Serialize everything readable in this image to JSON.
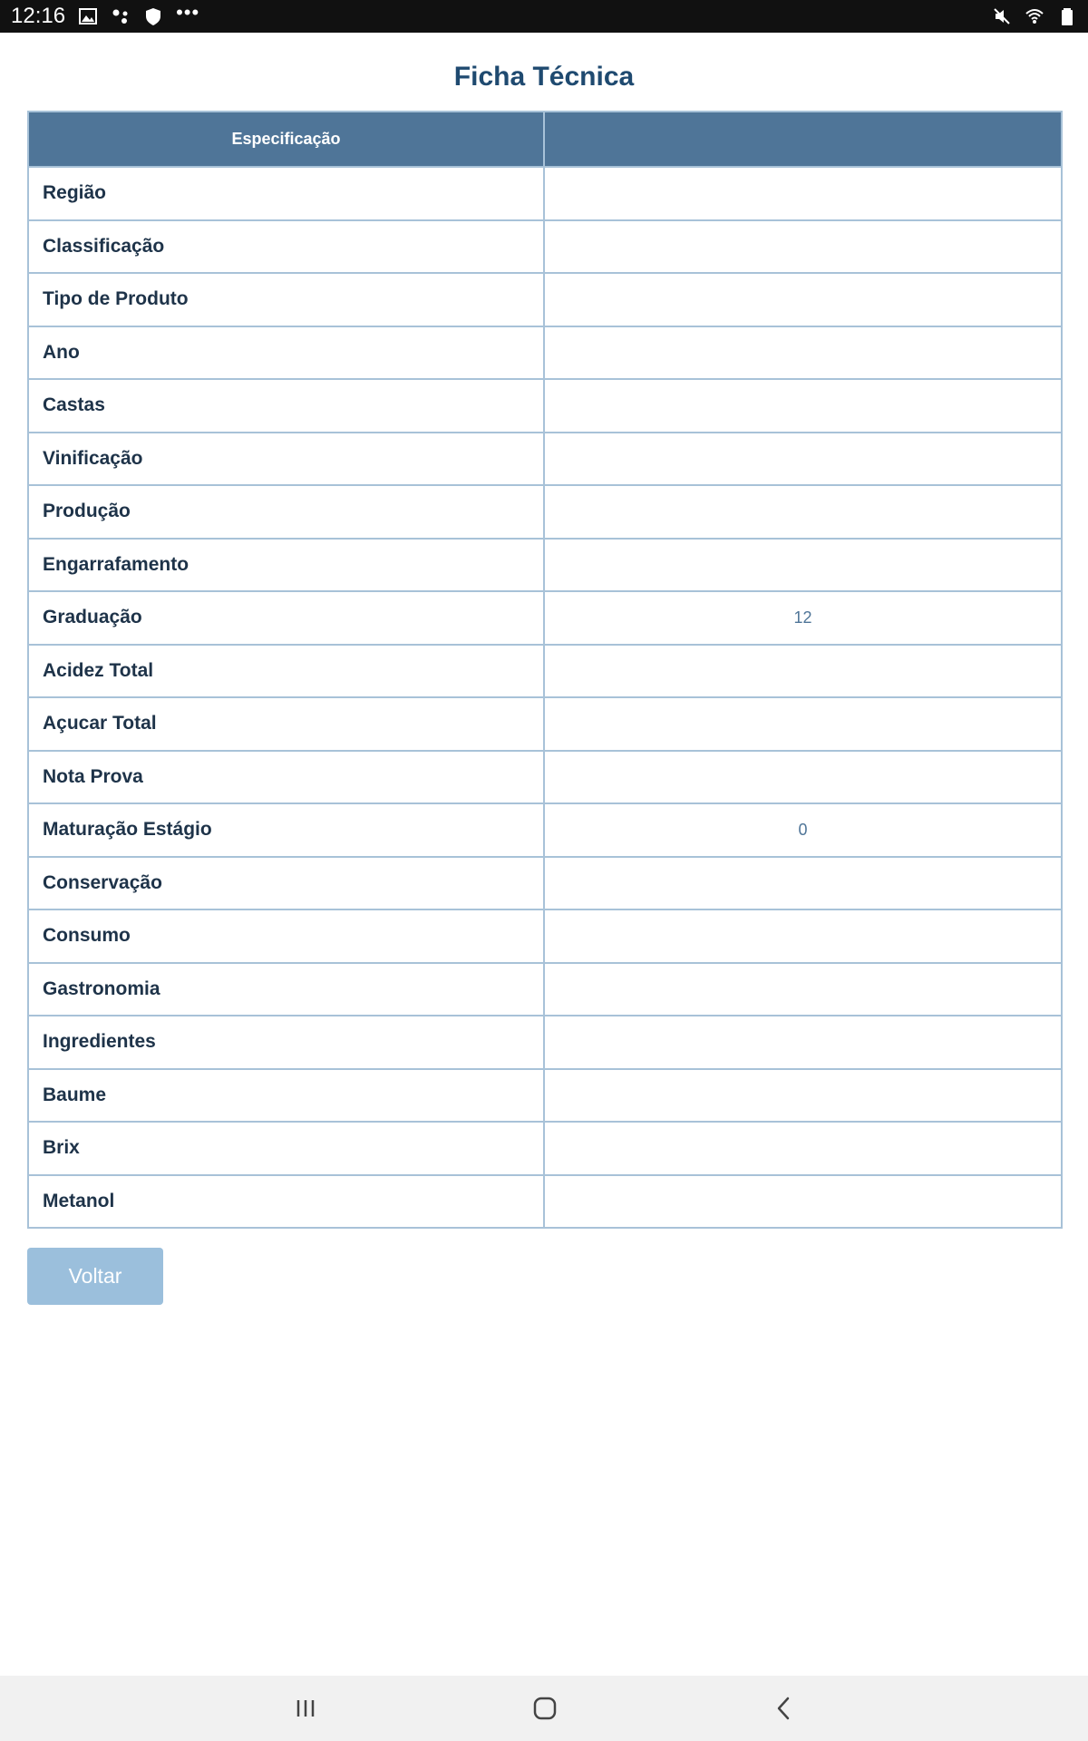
{
  "status_bar": {
    "time": "12:16",
    "left_icons": [
      "image-icon",
      "network-dots-icon",
      "shield-icon",
      "more-dots-icon"
    ],
    "right_icons": [
      "mute-icon",
      "wifi-icon",
      "battery-icon"
    ]
  },
  "page": {
    "title": "Ficha Técnica"
  },
  "table": {
    "header": [
      "Especificação",
      ""
    ],
    "rows": [
      {
        "label": "Região",
        "value": ""
      },
      {
        "label": "Classificação",
        "value": ""
      },
      {
        "label": "Tipo de Produto",
        "value": ""
      },
      {
        "label": "Ano",
        "value": ""
      },
      {
        "label": "Castas",
        "value": ""
      },
      {
        "label": "Vinificação",
        "value": ""
      },
      {
        "label": "Produção",
        "value": ""
      },
      {
        "label": "Engarrafamento",
        "value": ""
      },
      {
        "label": "Graduação",
        "value": "12"
      },
      {
        "label": "Acidez Total",
        "value": ""
      },
      {
        "label": "Açucar Total",
        "value": ""
      },
      {
        "label": "Nota Prova",
        "value": ""
      },
      {
        "label": "Maturação Estágio",
        "value": "0"
      },
      {
        "label": "Conservação",
        "value": ""
      },
      {
        "label": "Consumo",
        "value": ""
      },
      {
        "label": "Gastronomia",
        "value": ""
      },
      {
        "label": "Ingredientes",
        "value": ""
      },
      {
        "label": "Baume",
        "value": ""
      },
      {
        "label": "Brix",
        "value": ""
      },
      {
        "label": "Metanol",
        "value": ""
      }
    ]
  },
  "actions": {
    "back_label": "Voltar"
  },
  "nav_bar": {
    "icons": [
      "recents-icon",
      "home-icon",
      "back-icon"
    ]
  },
  "colors": {
    "title": "#1f4a70",
    "header_bg": "#4f7598",
    "border": "#a8c2d8",
    "label_text": "#1e3349",
    "value_text": "#4f7598",
    "button_bg": "#9bbfdc"
  }
}
